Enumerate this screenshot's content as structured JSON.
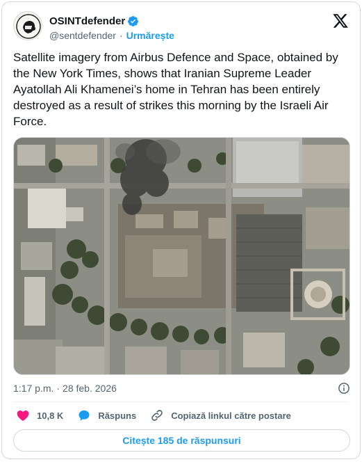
{
  "author": {
    "name": "OSINTdefender",
    "handle": "@sentdefender",
    "separator": "·",
    "follow_label": "Urmărește",
    "verified_color": "#1d9bf0"
  },
  "tweet": {
    "text": "Satellite imagery from Airbus Defence and Space, obtained by the New York Times, shows that Iranian Supreme Leader Ayatollah Ali Khamenei’s home in Tehran has been entirely destroyed as a result of strikes this morning by the Israeli Air Force.",
    "time": "1:17 p.m.",
    "meta_separator": "·",
    "date": "28 feb. 2026"
  },
  "actions": {
    "like_count": "10,8 K",
    "reply_label": "Răspuns",
    "copy_link_label": "Copiază linkul către postare",
    "like_color": "#f91880",
    "reply_color": "#1d9bf0"
  },
  "read_replies_label": "Citește 185 de răspunsuri",
  "icons": [
    "verified-badge-icon",
    "x-logo-icon",
    "info-icon",
    "heart-icon",
    "reply-bubble-icon",
    "link-icon"
  ]
}
